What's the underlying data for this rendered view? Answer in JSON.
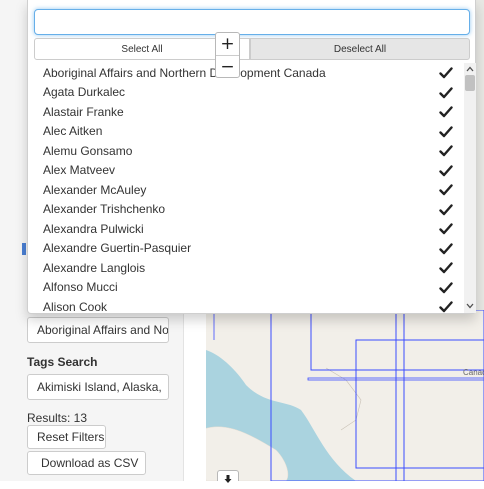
{
  "search": {
    "value": "",
    "placeholder": ""
  },
  "bulk": {
    "select_all": "Select All",
    "deselect_all": "Deselect All"
  },
  "zoom": {
    "in": "+",
    "out": "−"
  },
  "options": [
    {
      "label": "Aboriginal Affairs and Northern Development Canada",
      "checked": true
    },
    {
      "label": "Agata Durkalec",
      "checked": true
    },
    {
      "label": "Alastair Franke",
      "checked": true
    },
    {
      "label": "Alec Aitken",
      "checked": true
    },
    {
      "label": "Alemu Gonsamo",
      "checked": true
    },
    {
      "label": "Alex Matveev",
      "checked": true
    },
    {
      "label": "Alexander McAuley",
      "checked": true
    },
    {
      "label": "Alexander Trishchenko",
      "checked": true
    },
    {
      "label": "Alexandra Pulwicki",
      "checked": true
    },
    {
      "label": "Alexandre Guertin-Pasquier",
      "checked": true
    },
    {
      "label": "Alexandre Langlois",
      "checked": true
    },
    {
      "label": "Alfonso Mucci",
      "checked": true
    },
    {
      "label": "Alison Cook",
      "checked": true
    }
  ],
  "sidebar": {
    "author_select": "Aboriginal Affairs and No",
    "tags_label": "Tags Search",
    "tags_select": "Akimiski Island, Alaska, ",
    "results": "Results: 13",
    "reset_label": "Reset Filters",
    "download_label": "Download as CSV"
  },
  "map": {
    "place_label": "Canad"
  },
  "colors": {
    "accent": "#66afe9",
    "map_water": "#aad3df",
    "map_land": "#f2efe9",
    "footprint": "#3b4cff"
  }
}
